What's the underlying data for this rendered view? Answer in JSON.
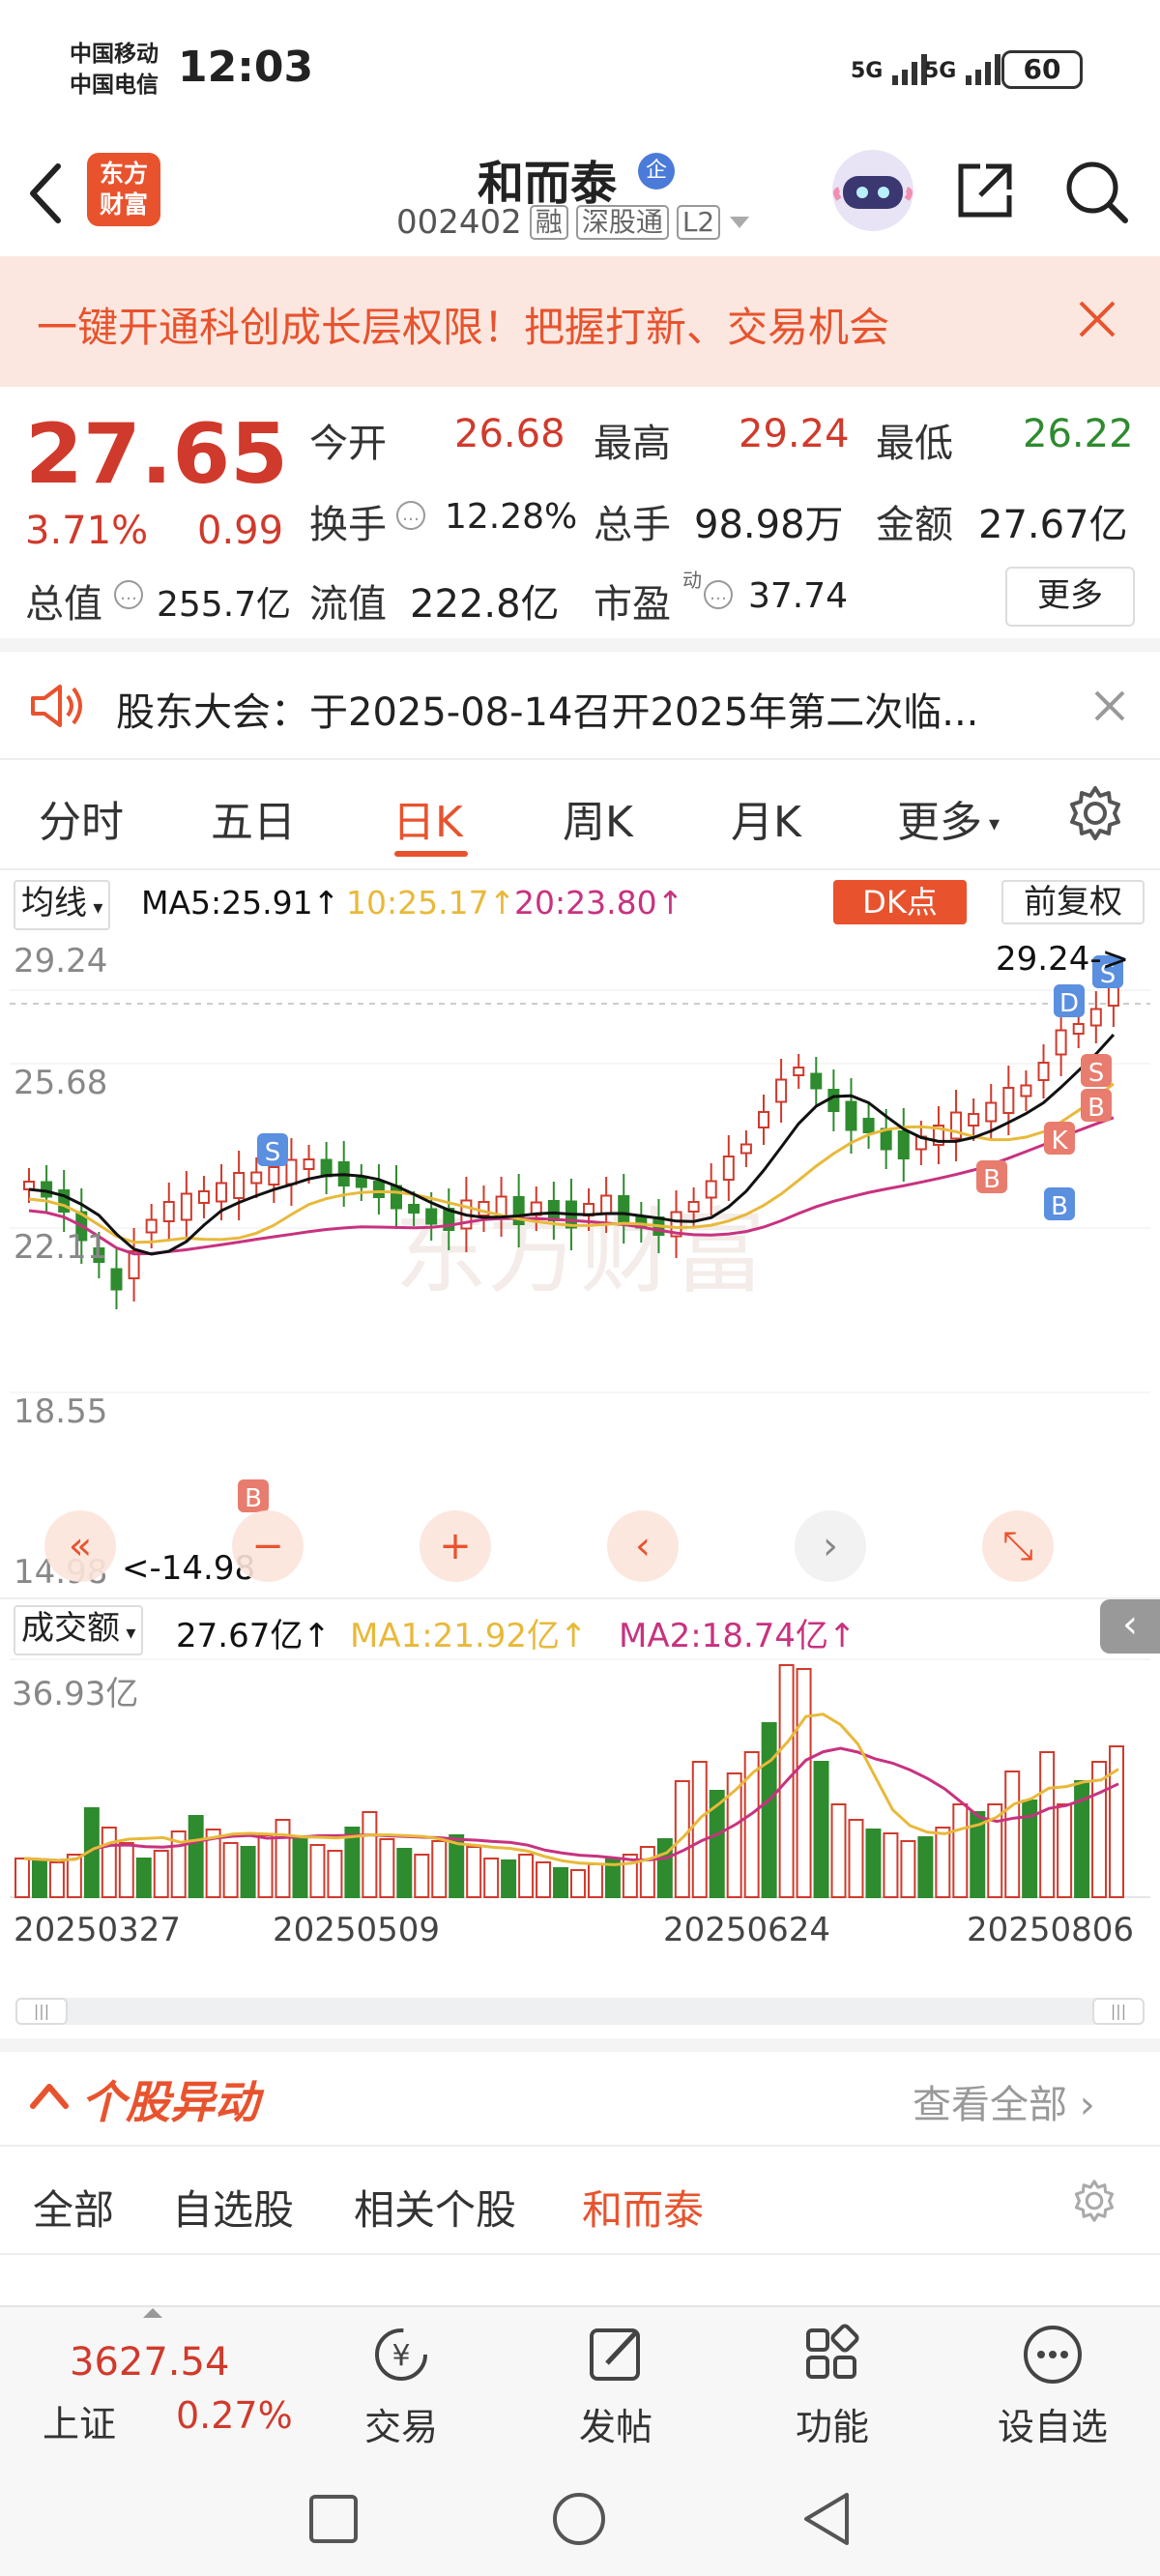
{
  "status_bar": {
    "carrier1": "中国移动",
    "carrier2": "中国电信",
    "time": "12:03",
    "signal1": "5G",
    "signal2": "5G",
    "battery": "60"
  },
  "header": {
    "logo_text1": "东方",
    "logo_text2": "财富",
    "title": "和而泰",
    "badge": "企",
    "code": "002402",
    "tag1": "融",
    "tag2": "深股通",
    "tag3": "L2"
  },
  "banner": {
    "text": "一键开通科创成长层权限！把握打新、交易机会"
  },
  "quote": {
    "price": "27.65",
    "change_pct": "3.71%",
    "change": "0.99",
    "open_label": "今开",
    "open": "26.68",
    "high_label": "最高",
    "high": "29.24",
    "low_label": "最低",
    "low": "26.22",
    "turnover_label": "换手",
    "turnover": "12.28%",
    "volume_label": "总手",
    "volume": "98.98万",
    "amount_label": "金额",
    "amount": "27.67亿",
    "mktcap_label": "总值",
    "mktcap": "255.7亿",
    "float_label": "流值",
    "float": "222.8亿",
    "pe_label": "市盈",
    "pe_sup": "动",
    "pe": "37.74",
    "more": "更多"
  },
  "notice": {
    "text": "股东大会：于2025-08-14召开2025年第二次临..."
  },
  "tabs": [
    "分时",
    "五日",
    "日K",
    "周K",
    "月K",
    "更多"
  ],
  "active_tab": "日K",
  "kline": {
    "ma_selector": "均线",
    "ma5": "MA5:25.91↑",
    "ma10": "10:25.17↑",
    "ma20": "20:23.80↑",
    "dk_button": "DK点",
    "adjust": "前复权",
    "ylabels": [
      "29.24",
      "25.68",
      "22.11",
      "18.55",
      "14.98"
    ],
    "high_mark": "29.24->",
    "low_mark": "<-14.98",
    "watermark": "东方财富",
    "signals": [
      "S",
      "B",
      "D",
      "K",
      "S",
      "B",
      "B",
      "B",
      "S"
    ],
    "colors": {
      "up": "#d03a2c",
      "down": "#2e8b2e",
      "ma5": "#111111",
      "ma10": "#e8b93a",
      "ma20": "#c8327f"
    }
  },
  "volume": {
    "selector": "成交额",
    "amount": "27.67亿↑",
    "ma1": "MA1:21.92亿↑",
    "ma2": "MA2:18.74亿↑",
    "ymax": "36.93亿",
    "dates": [
      "20250327",
      "20250509",
      "20250624",
      "20250806"
    ]
  },
  "movers": {
    "title": "个股异动",
    "see_all": "查看全部",
    "filters": [
      "全部",
      "自选股",
      "相关个股",
      "和而泰"
    ],
    "active_filter": "和而泰"
  },
  "bottom_nav": {
    "index_value": "3627.54",
    "index_name": "上证",
    "index_change": "0.27%",
    "items": [
      "交易",
      "发帖",
      "功能",
      "设自选"
    ]
  }
}
